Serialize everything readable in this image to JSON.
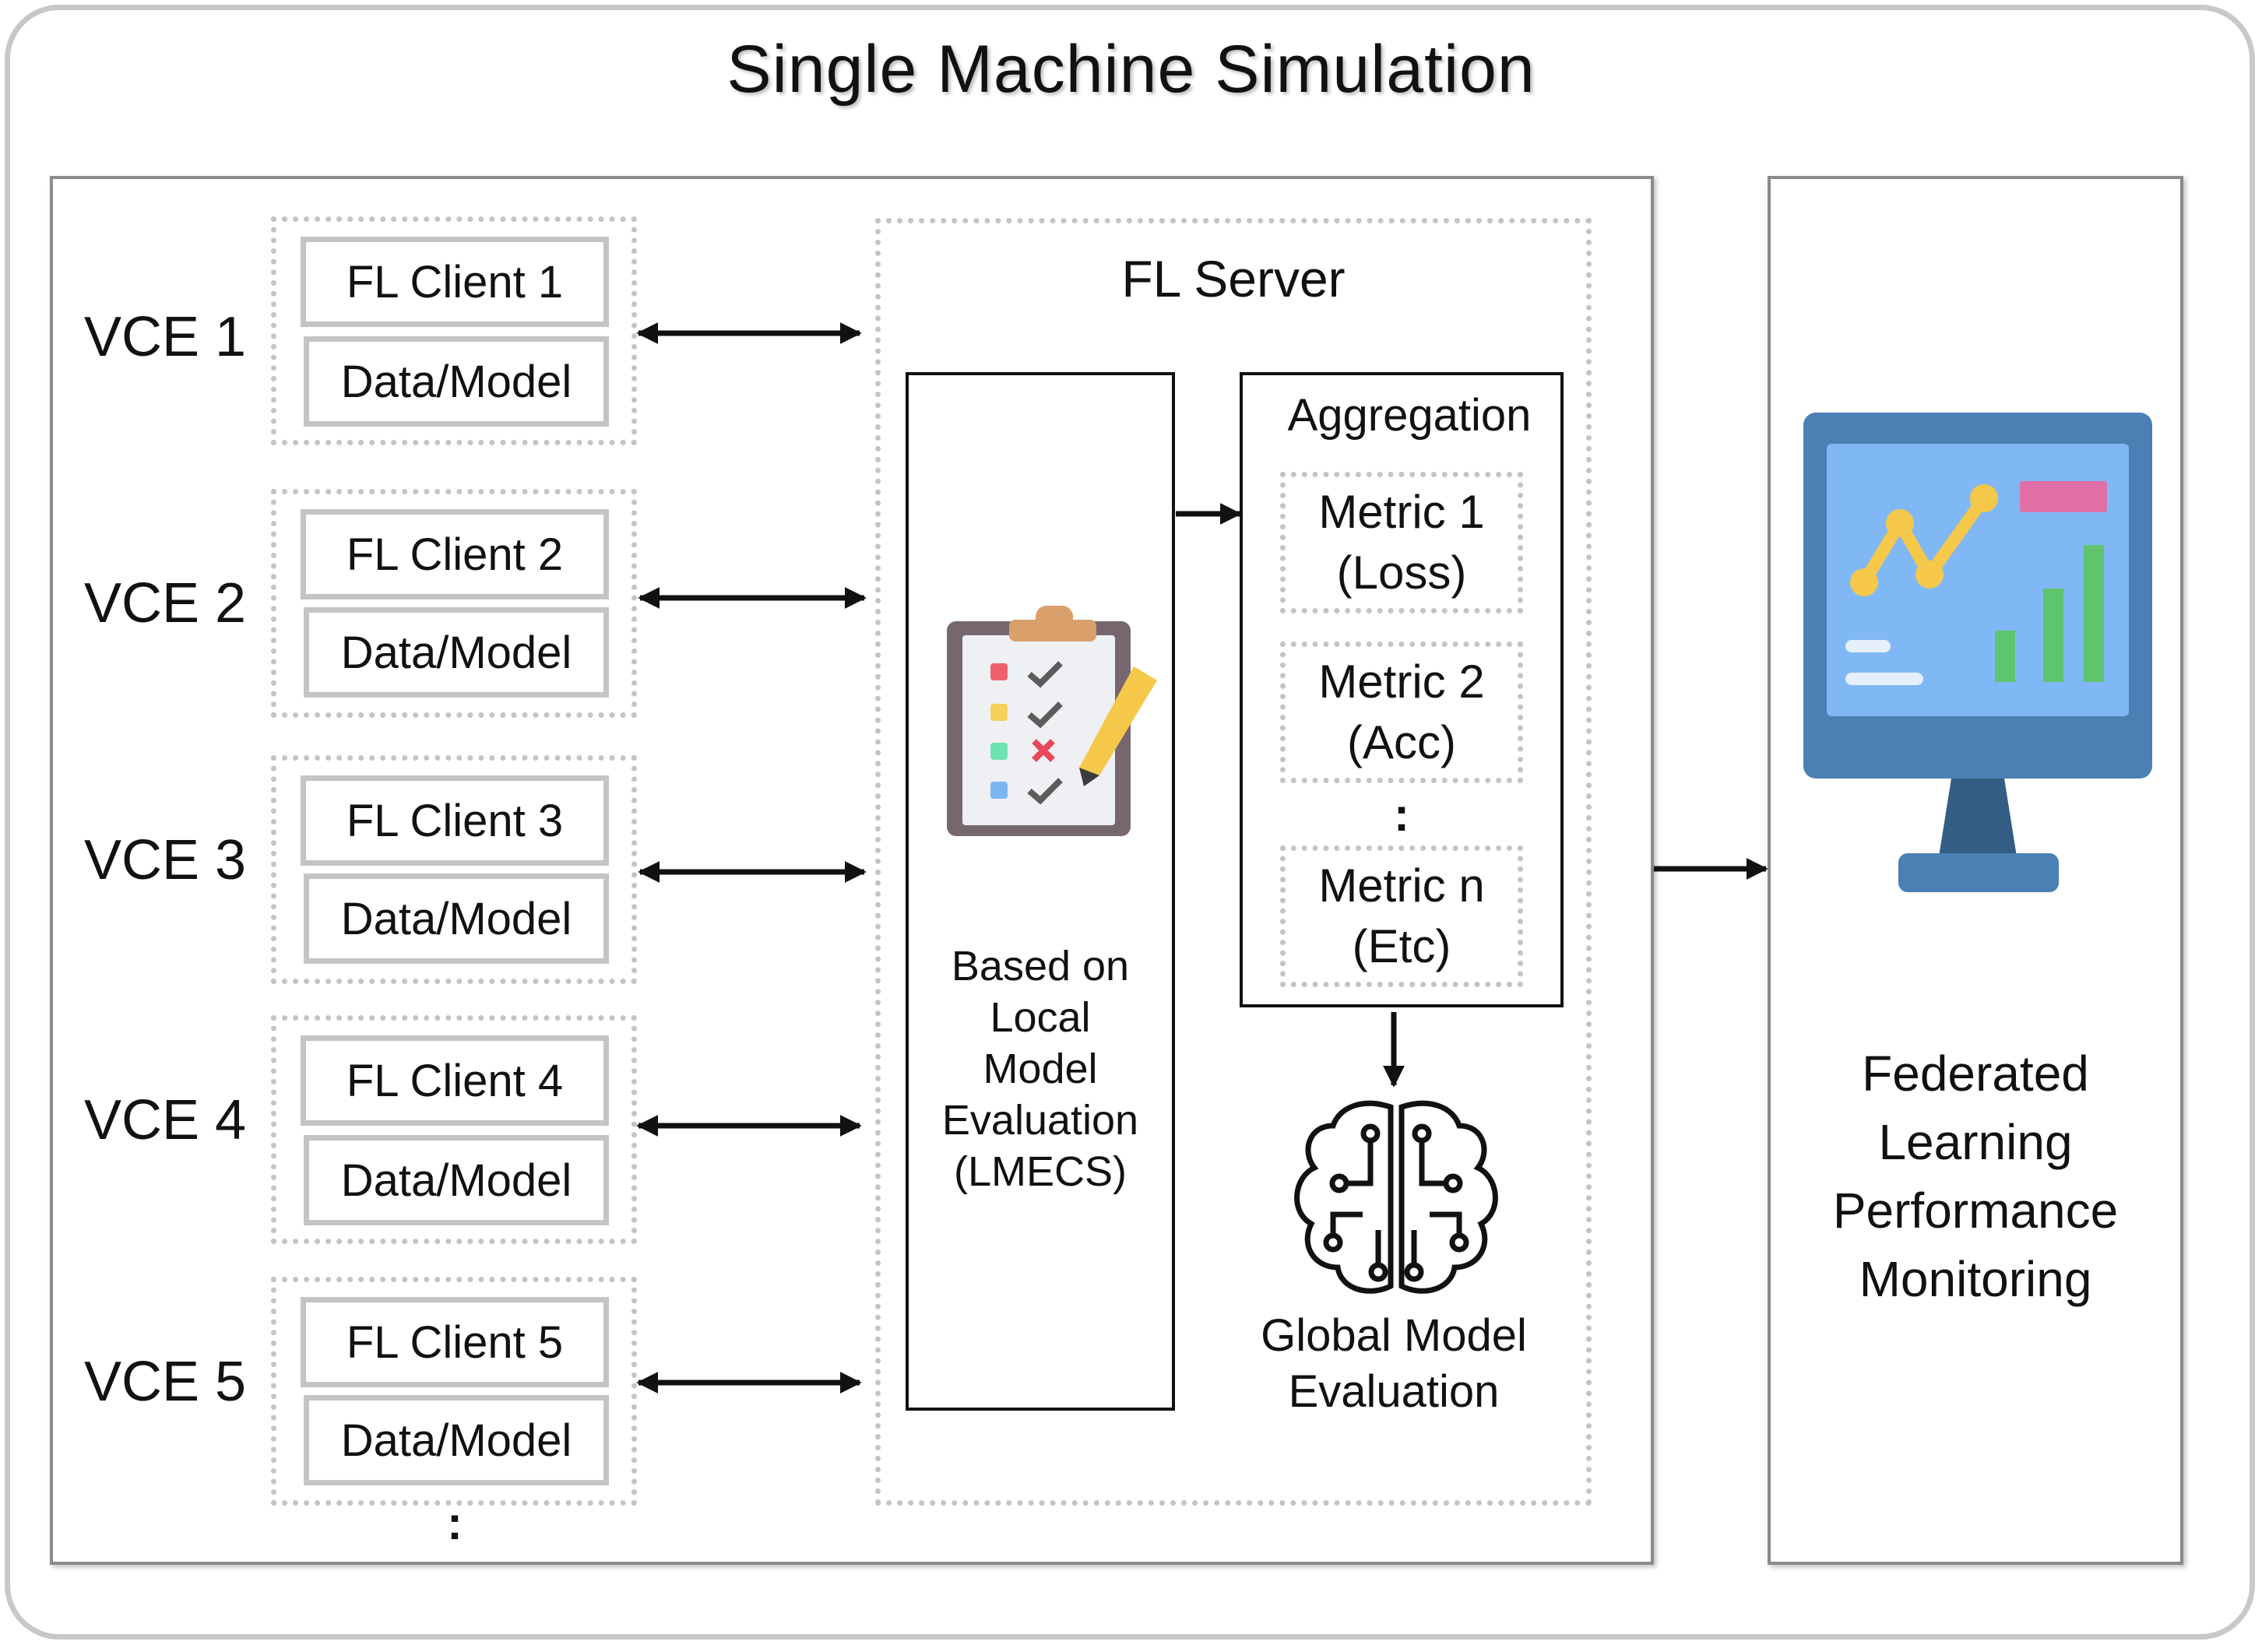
{
  "title": "Single Machine Simulation",
  "clients": [
    {
      "vce": "VCE 1",
      "client": "FL Client 1",
      "data": "Data/Model"
    },
    {
      "vce": "VCE 2",
      "client": "FL Client 2",
      "data": "Data/Model"
    },
    {
      "vce": "VCE 3",
      "client": "FL Client 3",
      "data": "Data/Model"
    },
    {
      "vce": "VCE 4",
      "client": "FL Client 4",
      "data": "Data/Model"
    },
    {
      "vce": "VCE 5",
      "client": "FL Client 5",
      "data": "Data/Model"
    }
  ],
  "clients_ellipsis": ":",
  "server": {
    "label": "FL Server",
    "local_eval": [
      "Based on",
      "Local",
      "Model",
      "Evaluation",
      "(LMECS)"
    ],
    "aggregation": "Aggregation",
    "metrics": [
      {
        "line1": "Metric 1",
        "line2": "(Loss)"
      },
      {
        "line1": "Metric 2",
        "line2": "(Acc)"
      },
      {
        "line1": "Metric n",
        "line2": "(Etc)"
      }
    ],
    "metrics_ellipsis": ":",
    "global_eval": [
      "Global Model",
      "Evaluation"
    ]
  },
  "monitoring": [
    "Federated",
    "Learning",
    "Performance",
    "Monitoring"
  ],
  "icons": {
    "clipboard": "checklist-clipboard-icon",
    "brain": "circuit-brain-icon",
    "monitor": "dashboard-monitor-icon"
  },
  "colors": {
    "monitor_frame": "#4a80b4",
    "monitor_screen": "#80b8f5",
    "chart_line": "#f5c84a",
    "bars": "#5ec46e",
    "badge": "#e06fa6",
    "clipboard_clip": "#d9a06b",
    "pencil": "#f5c84a"
  }
}
